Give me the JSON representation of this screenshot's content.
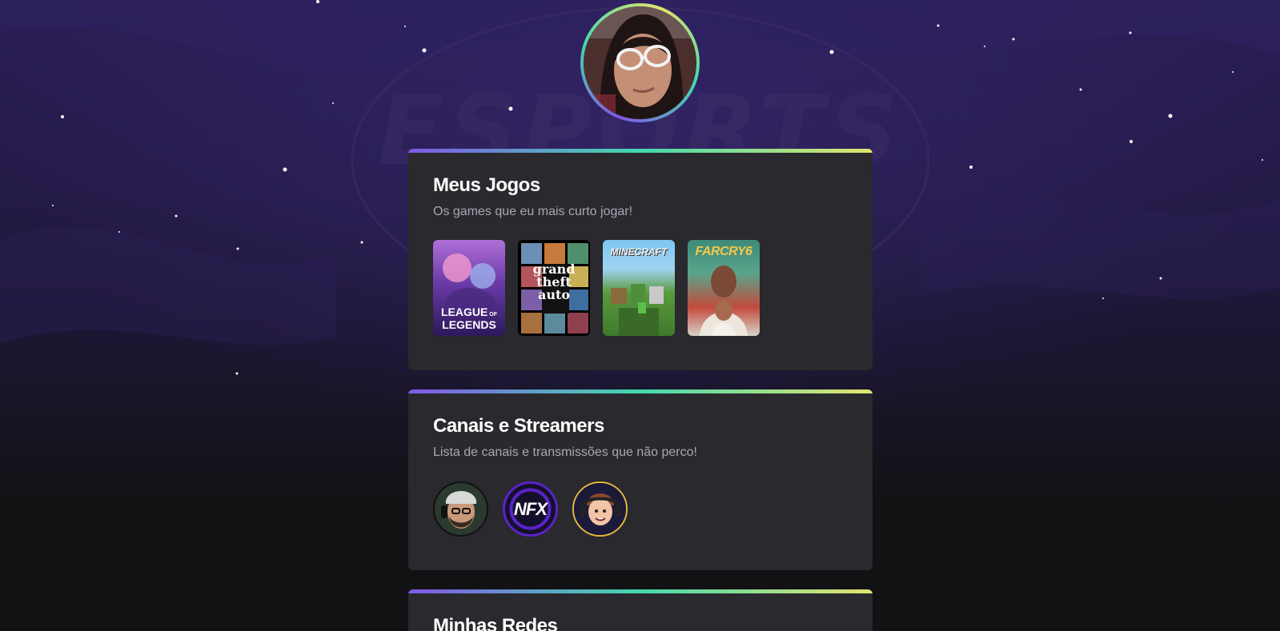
{
  "profile": {
    "avatar_icon": "profile-photo"
  },
  "background": {
    "watermark_text": "ESPORTS"
  },
  "games_section": {
    "title": "Meus Jogos",
    "subtitle": "Os games que eu mais curto jogar!",
    "games": [
      {
        "label": "LEAGUE OF LEGENDS",
        "label_line1": "LEAGUE",
        "label_line2": "LEGENDS",
        "label_of": "OF"
      },
      {
        "label": "grand theft auto V",
        "line1": "grand",
        "line2": "theft",
        "line3": "auto"
      },
      {
        "label": "MINECRAFT"
      },
      {
        "label": "FARCRY6"
      }
    ]
  },
  "streamers_section": {
    "title": "Canais e Streamers",
    "subtitle": "Lista de canais e transmissões que não perco!",
    "streamers": [
      {
        "icon": "streamer-avatar-bearded"
      },
      {
        "icon": "nfx-logo",
        "label": "NFX"
      },
      {
        "icon": "streamer-avatar-cartoon"
      }
    ]
  },
  "social_section": {
    "title": "Minhas Redes"
  },
  "colors": {
    "gradient_start": "#8257e5",
    "gradient_mid": "#43d9ad",
    "gradient_end": "#e4e36e",
    "card_bg": "#29292e",
    "page_bg": "#121214"
  }
}
